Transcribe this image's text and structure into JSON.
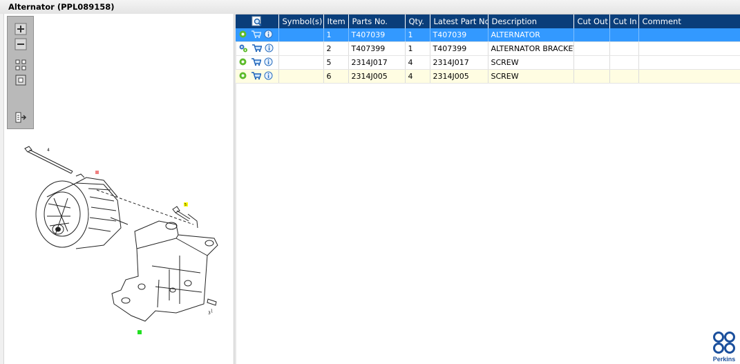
{
  "window": {
    "title": "Alternator (PPL089158)"
  },
  "toolbar": {
    "tools": [
      "zoom-in-icon",
      "zoom-out-icon",
      "fit-all-icon",
      "fit-window-icon",
      "export-icon"
    ]
  },
  "diagram": {
    "callouts": [
      "4",
      "5",
      "3"
    ]
  },
  "table": {
    "columns": [
      "Symbol(s)",
      "Item",
      "Parts No.",
      "Qty.",
      "Latest Part No.",
      "Description",
      "Cut Out",
      "Cut In",
      "Comment"
    ],
    "rows": [
      {
        "item": "1",
        "parts_no": "T407039",
        "qty": "1",
        "latest": "T407039",
        "desc": "ALTERNATOR",
        "cut_out": "",
        "cut_in": "",
        "comment": "",
        "icon": "gear-icon"
      },
      {
        "item": "2",
        "parts_no": "T407399",
        "qty": "1",
        "latest": "T407399",
        "desc": "ALTERNATOR BRACKET",
        "cut_out": "",
        "cut_in": "",
        "comment": "",
        "icon": "gears-icon"
      },
      {
        "item": "5",
        "parts_no": "2314J017",
        "qty": "4",
        "latest": "2314J017",
        "desc": "SCREW",
        "cut_out": "",
        "cut_in": "",
        "comment": "",
        "icon": "gear-icon"
      },
      {
        "item": "6",
        "parts_no": "2314J005",
        "qty": "4",
        "latest": "2314J005",
        "desc": "SCREW",
        "cut_out": "",
        "cut_in": "",
        "comment": "",
        "icon": "gear-icon"
      }
    ]
  },
  "logo": {
    "brand": "Perkins"
  },
  "colors": {
    "header": "#0a3e7a",
    "selected": "#3399ff",
    "alt_row": "#fffde2",
    "accent": "#1a4f9c"
  }
}
